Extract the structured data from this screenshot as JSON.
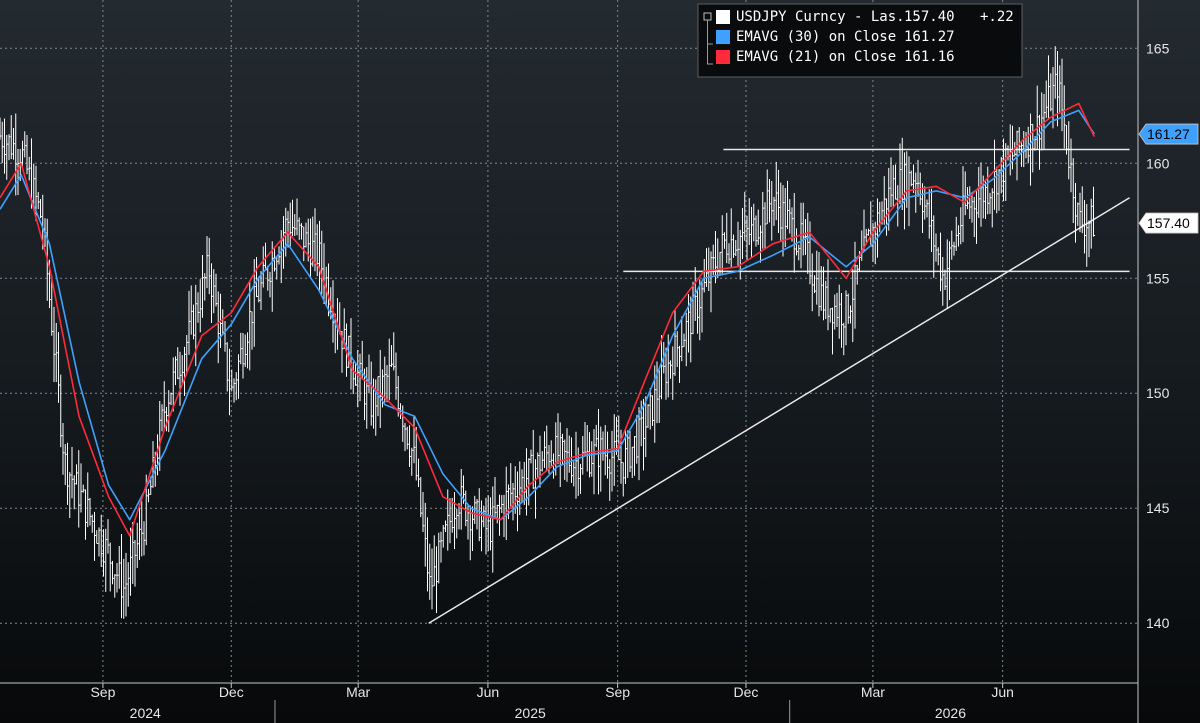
{
  "chart_data": {
    "type": "line",
    "instrument": "USDJPY Curncy",
    "legend": [
      {
        "name": "USDJPY Curncy - Las...",
        "value": "157.40",
        "change": "+.22",
        "color": "#ffffff",
        "icon": "collapse-box-icon"
      },
      {
        "name": "EMAVG (30)  on Close",
        "value": "161.27",
        "color": "#3fa1ff"
      },
      {
        "name": "EMAVG (21)  on Close",
        "value": "161.16",
        "color": "#ff2a3a"
      }
    ],
    "last_price_tag": "157.40",
    "ema30_tag": "161.27",
    "y_axis": {
      "ticks": [
        "140",
        "145",
        "150",
        "155",
        "160",
        "165"
      ],
      "range": [
        137.4,
        167.1
      ],
      "position": "right"
    },
    "x_axis": {
      "months": [
        "Sep",
        "Dec",
        "Mar",
        "Jun",
        "Sep",
        "Dec",
        "Mar",
        "Jun"
      ],
      "years": [
        "2024",
        "2025",
        "2026"
      ]
    },
    "grid": true,
    "legend_position": "top-right",
    "series": [
      {
        "name": "USDJPY Curncy",
        "style": "ohlc-bars",
        "color": "#ffffff",
        "x": [
          "2024-06-20",
          "2024-07-05",
          "2024-07-20",
          "2024-08-05",
          "2024-08-20",
          "2024-09-05",
          "2024-09-16",
          "2024-10-01",
          "2024-10-15",
          "2024-11-01",
          "2024-11-15",
          "2024-12-01",
          "2024-12-15",
          "2025-01-10",
          "2025-02-01",
          "2025-02-20",
          "2025-03-10",
          "2025-03-25",
          "2025-04-10",
          "2025-04-21",
          "2025-05-10",
          "2025-06-01",
          "2025-06-15",
          "2025-07-01",
          "2025-07-15",
          "2025-08-01",
          "2025-08-20",
          "2025-09-05",
          "2025-09-20",
          "2025-10-05",
          "2025-10-25",
          "2025-11-15",
          "2025-12-05",
          "2025-12-20",
          "2026-01-10",
          "2026-01-25",
          "2026-02-10",
          "2026-02-25",
          "2026-03-15",
          "2026-04-01",
          "2026-04-20",
          "2026-05-05",
          "2026-05-20",
          "2026-06-10",
          "2026-06-25",
          "2026-07-10",
          "2026-07-25",
          "2026-08-05"
        ],
        "y": [
          161.2,
          160.5,
          157.5,
          147.0,
          145.0,
          143.0,
          141.5,
          144.5,
          149.5,
          152.5,
          155.5,
          150.0,
          153.5,
          157.5,
          156.0,
          152.0,
          149.5,
          151.0,
          147.0,
          141.5,
          145.5,
          144.0,
          145.5,
          146.5,
          147.5,
          147.0,
          147.5,
          147.0,
          148.5,
          151.0,
          153.5,
          156.5,
          157.0,
          158.5,
          156.5,
          154.0,
          153.5,
          156.5,
          159.0,
          159.5,
          155.0,
          158.0,
          158.8,
          160.5,
          161.5,
          163.5,
          157.5,
          157.4
        ]
      },
      {
        "name": "EMAVG (30) on Close",
        "color": "#3fa1ff",
        "x": [
          "2024-06-20",
          "2024-07-05",
          "2024-07-25",
          "2024-08-15",
          "2024-09-05",
          "2024-09-20",
          "2024-10-15",
          "2024-11-10",
          "2024-12-01",
          "2024-12-20",
          "2025-01-10",
          "2025-02-01",
          "2025-02-25",
          "2025-03-20",
          "2025-04-10",
          "2025-04-30",
          "2025-05-20",
          "2025-06-10",
          "2025-06-30",
          "2025-07-20",
          "2025-08-10",
          "2025-09-01",
          "2025-09-20",
          "2025-10-10",
          "2025-11-01",
          "2025-11-25",
          "2025-12-20",
          "2026-01-15",
          "2026-02-10",
          "2026-03-01",
          "2026-03-25",
          "2026-04-15",
          "2026-05-05",
          "2026-05-25",
          "2026-06-15",
          "2026-07-05",
          "2026-07-25",
          "2026-08-05"
        ],
        "y": [
          158.0,
          159.5,
          156.5,
          150.5,
          146.0,
          144.5,
          147.5,
          151.5,
          153.0,
          155.0,
          156.5,
          154.5,
          151.5,
          149.5,
          149.0,
          146.5,
          145.0,
          144.5,
          145.5,
          146.8,
          147.3,
          147.5,
          149.5,
          152.5,
          155.0,
          155.3,
          156.0,
          156.8,
          155.5,
          156.5,
          158.5,
          158.8,
          158.5,
          159.3,
          160.5,
          161.8,
          162.3,
          161.27
        ]
      },
      {
        "name": "EMAVG (21) on Close",
        "color": "#ff2a3a",
        "x": [
          "2024-06-20",
          "2024-07-05",
          "2024-07-25",
          "2024-08-15",
          "2024-09-05",
          "2024-09-20",
          "2024-10-15",
          "2024-11-10",
          "2024-12-01",
          "2024-12-20",
          "2025-01-10",
          "2025-02-01",
          "2025-02-25",
          "2025-03-20",
          "2025-04-10",
          "2025-04-30",
          "2025-05-20",
          "2025-06-10",
          "2025-06-30",
          "2025-07-20",
          "2025-08-10",
          "2025-09-01",
          "2025-09-20",
          "2025-10-10",
          "2025-11-01",
          "2025-11-25",
          "2025-12-20",
          "2026-01-15",
          "2026-02-10",
          "2026-03-01",
          "2026-03-25",
          "2026-04-15",
          "2026-05-05",
          "2026-05-25",
          "2026-06-15",
          "2026-07-05",
          "2026-07-25",
          "2026-08-05"
        ],
        "y": [
          158.5,
          160.0,
          155.5,
          149.0,
          145.5,
          143.8,
          148.5,
          152.5,
          153.5,
          155.5,
          157.0,
          155.5,
          151.0,
          149.8,
          148.5,
          145.5,
          144.8,
          144.5,
          146.0,
          147.0,
          147.4,
          147.6,
          150.5,
          153.5,
          155.3,
          155.5,
          156.5,
          157.0,
          155.0,
          157.0,
          158.8,
          159.0,
          158.3,
          159.6,
          161.0,
          162.0,
          162.6,
          161.16
        ]
      }
    ],
    "trendlines": [
      {
        "from": [
          "2025-04-20",
          140.0
        ],
        "to": [
          "2026-08-30",
          158.5
        ]
      },
      {
        "from": [
          "2025-09-05",
          155.3
        ],
        "to": [
          "2026-08-30",
          155.3
        ]
      },
      {
        "from": [
          "2025-11-15",
          160.6
        ],
        "to": [
          "2026-08-30",
          160.6
        ]
      }
    ]
  }
}
